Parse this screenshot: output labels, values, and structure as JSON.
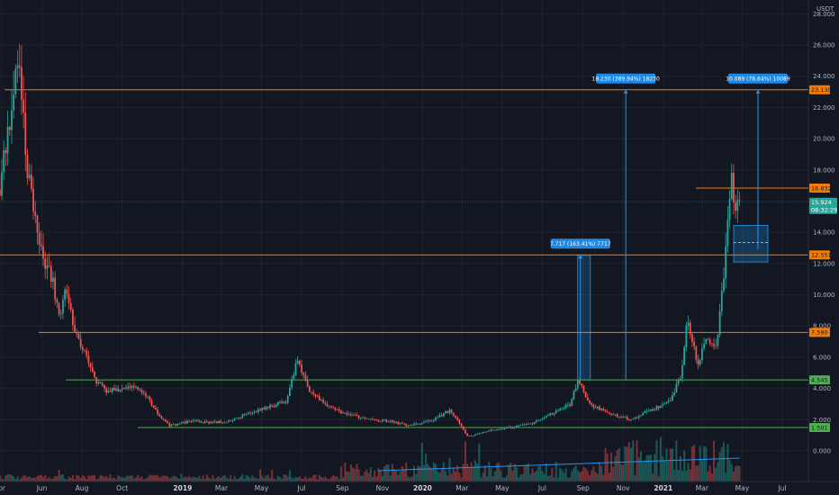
{
  "chart_data": {
    "type": "candlestick",
    "quote_unit": "USDT",
    "x_ticks": [
      {
        "date": "2018-04-01",
        "label": "pr",
        "major": false
      },
      {
        "date": "2018-06-01",
        "label": "Jun",
        "major": false
      },
      {
        "date": "2018-08-01",
        "label": "Aug",
        "major": false
      },
      {
        "date": "2018-10-01",
        "label": "Oct",
        "major": false
      },
      {
        "date": "2019-01-01",
        "label": "2019",
        "major": true
      },
      {
        "date": "2019-03-01",
        "label": "Mar",
        "major": false
      },
      {
        "date": "2019-05-01",
        "label": "May",
        "major": false
      },
      {
        "date": "2019-07-01",
        "label": "Jul",
        "major": false
      },
      {
        "date": "2019-09-01",
        "label": "Sep",
        "major": false
      },
      {
        "date": "2019-11-01",
        "label": "Nov",
        "major": false
      },
      {
        "date": "2020-01-01",
        "label": "2020",
        "major": true
      },
      {
        "date": "2020-03-01",
        "label": "Mar",
        "major": false
      },
      {
        "date": "2020-05-01",
        "label": "May",
        "major": false
      },
      {
        "date": "2020-07-01",
        "label": "Jul",
        "major": false
      },
      {
        "date": "2020-09-01",
        "label": "Sep",
        "major": false
      },
      {
        "date": "2020-11-01",
        "label": "Nov",
        "major": false
      },
      {
        "date": "2021-01-01",
        "label": "2021",
        "major": true
      },
      {
        "date": "2021-03-01",
        "label": "Mar",
        "major": false
      },
      {
        "date": "2021-05-01",
        "label": "May",
        "major": false
      },
      {
        "date": "2021-07-01",
        "label": "Jul",
        "major": false
      }
    ],
    "y_ticks": [
      {
        "value": 0,
        "label": "0.000"
      },
      {
        "value": 2,
        "label": "2.000"
      },
      {
        "value": 4,
        "label": "4.000"
      },
      {
        "value": 6,
        "label": "6.000"
      },
      {
        "value": 8,
        "label": "8.000"
      },
      {
        "value": 10,
        "label": "10.000"
      },
      {
        "value": 12,
        "label": "12.000"
      },
      {
        "value": 14,
        "label": "14.000"
      },
      {
        "value": 16,
        "label": "16.000"
      },
      {
        "value": 18,
        "label": "18.000"
      },
      {
        "value": 20,
        "label": "20.000"
      },
      {
        "value": 22,
        "label": "22.000"
      },
      {
        "value": 24,
        "label": "24.000"
      },
      {
        "value": 26,
        "label": "26.000"
      },
      {
        "value": 28,
        "label": "28.000"
      }
    ],
    "price_path": [
      {
        "date": "2018-03-20",
        "value": 14.0
      },
      {
        "date": "2018-04-05",
        "value": 18.0
      },
      {
        "date": "2018-04-18",
        "value": 21.5
      },
      {
        "date": "2018-04-30",
        "value": 25.8
      },
      {
        "date": "2018-05-12",
        "value": 18.5
      },
      {
        "date": "2018-05-22",
        "value": 15.5
      },
      {
        "date": "2018-06-05",
        "value": 12.5
      },
      {
        "date": "2018-06-20",
        "value": 11.0
      },
      {
        "date": "2018-07-01",
        "value": 8.5
      },
      {
        "date": "2018-07-10",
        "value": 10.3
      },
      {
        "date": "2018-07-25",
        "value": 7.6
      },
      {
        "date": "2018-08-10",
        "value": 6.0
      },
      {
        "date": "2018-08-25",
        "value": 4.5
      },
      {
        "date": "2018-09-10",
        "value": 3.8
      },
      {
        "date": "2018-10-01",
        "value": 4.0
      },
      {
        "date": "2018-10-20",
        "value": 4.2
      },
      {
        "date": "2018-11-10",
        "value": 3.5
      },
      {
        "date": "2018-11-25",
        "value": 2.5
      },
      {
        "date": "2018-12-15",
        "value": 1.6
      },
      {
        "date": "2019-01-15",
        "value": 1.9
      },
      {
        "date": "2019-02-15",
        "value": 1.8
      },
      {
        "date": "2019-03-15",
        "value": 1.9
      },
      {
        "date": "2019-04-15",
        "value": 2.4
      },
      {
        "date": "2019-05-15",
        "value": 2.8
      },
      {
        "date": "2019-06-10",
        "value": 3.2
      },
      {
        "date": "2019-06-28",
        "value": 5.9
      },
      {
        "date": "2019-07-15",
        "value": 3.8
      },
      {
        "date": "2019-08-15",
        "value": 2.8
      },
      {
        "date": "2019-09-15",
        "value": 2.3
      },
      {
        "date": "2019-10-15",
        "value": 2.0
      },
      {
        "date": "2019-11-15",
        "value": 1.9
      },
      {
        "date": "2019-12-15",
        "value": 1.6
      },
      {
        "date": "2020-01-15",
        "value": 1.9
      },
      {
        "date": "2020-02-15",
        "value": 2.6
      },
      {
        "date": "2020-03-13",
        "value": 0.9
      },
      {
        "date": "2020-04-15",
        "value": 1.3
      },
      {
        "date": "2020-05-15",
        "value": 1.5
      },
      {
        "date": "2020-06-15",
        "value": 1.7
      },
      {
        "date": "2020-07-15",
        "value": 2.3
      },
      {
        "date": "2020-08-15",
        "value": 3.0
      },
      {
        "date": "2020-08-28",
        "value": 4.5
      },
      {
        "date": "2020-09-15",
        "value": 3.0
      },
      {
        "date": "2020-10-15",
        "value": 2.4
      },
      {
        "date": "2020-11-15",
        "value": 2.0
      },
      {
        "date": "2020-12-15",
        "value": 2.6
      },
      {
        "date": "2021-01-15",
        "value": 3.2
      },
      {
        "date": "2021-02-01",
        "value": 5.0
      },
      {
        "date": "2021-02-10",
        "value": 8.5
      },
      {
        "date": "2021-02-25",
        "value": 5.5
      },
      {
        "date": "2021-03-10",
        "value": 7.0
      },
      {
        "date": "2021-03-25",
        "value": 6.5
      },
      {
        "date": "2021-04-05",
        "value": 11.0
      },
      {
        "date": "2021-04-12",
        "value": 14.5
      },
      {
        "date": "2021-04-18",
        "value": 17.3
      },
      {
        "date": "2021-04-22",
        "value": 15.4
      },
      {
        "date": "2021-04-27",
        "value": 15.9
      }
    ],
    "horizontal_levels": [
      {
        "value": 23.13,
        "label": "23.130",
        "color": "#f57c00"
      },
      {
        "value": 16.832,
        "label": "16.832",
        "color": "#f57c00"
      },
      {
        "value": 12.551,
        "label": "12.551",
        "color": "#f57c00"
      },
      {
        "value": 7.59,
        "label": "7.590",
        "color": "#f57c00"
      },
      {
        "value": 4.545,
        "label": "4.545",
        "color": "#4caf50"
      },
      {
        "value": 1.501,
        "label": "1.501",
        "color": "#4caf50"
      }
    ],
    "current_price": {
      "value": 15.924,
      "label": "15.924",
      "countdown": "08:32:29",
      "color": "#26a69a"
    },
    "measure_annotations": [
      {
        "date": "2020-08-28",
        "from": 4.545,
        "to": 12.551,
        "label": "7.717 (163.41%) 7717"
      },
      {
        "date": "2020-11-05",
        "from": 4.545,
        "to": 23.13,
        "label": "18.230 (389.94%) 18230"
      },
      {
        "date": "2021-05-25",
        "from": 12.9,
        "to": 23.13,
        "label": "10.089 (78.64%) 10089"
      }
    ],
    "volume_trendline": {
      "from": "2019-10-25",
      "to": "2021-04-27"
    },
    "accent_colors": {
      "up": "#26a69a",
      "down": "#ef5350",
      "level": "#f57c00",
      "support": "#4caf50",
      "measure": "#2196f3"
    }
  }
}
